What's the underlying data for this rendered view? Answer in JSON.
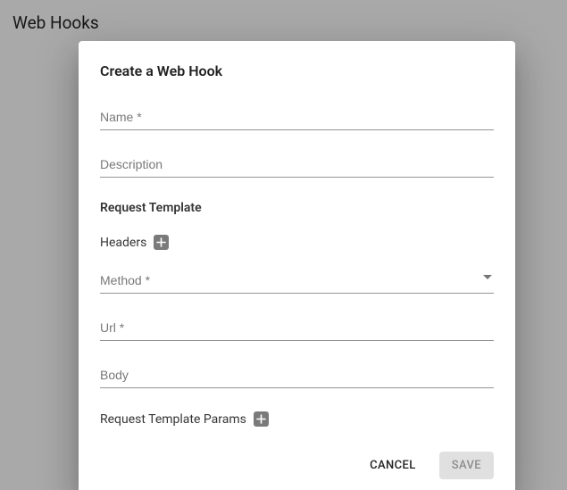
{
  "page": {
    "title": "Web Hooks"
  },
  "dialog": {
    "title": "Create a Web Hook",
    "fields": {
      "name": {
        "placeholder": "Name *",
        "value": ""
      },
      "description": {
        "placeholder": "Description",
        "value": ""
      },
      "method": {
        "placeholder": "Method *",
        "value": ""
      },
      "url": {
        "placeholder": "Url *",
        "value": ""
      },
      "body": {
        "placeholder": "Body",
        "value": ""
      }
    },
    "sections": {
      "requestTemplate": "Request Template",
      "headers": "Headers",
      "requestTemplateParams": "Request Template Params"
    },
    "actions": {
      "cancel": "CANCEL",
      "save": "SAVE"
    }
  }
}
